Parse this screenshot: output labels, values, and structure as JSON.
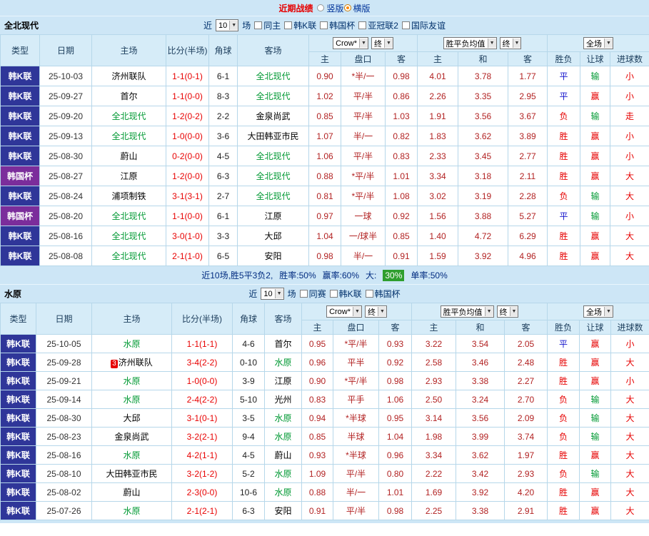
{
  "topbar": {
    "title": "近期战绩",
    "radios": [
      {
        "label": "竖版",
        "selected": false
      },
      {
        "label": "横版",
        "selected": true
      }
    ]
  },
  "colors": {
    "accent_red": "#e60000",
    "result_blue": "#1414cc",
    "result_green": "#009933",
    "focus_team_green": "#009933",
    "league_navy": "#2f3699",
    "cup_purple": "#7b2d9b",
    "panel_blue": "#cde6f6",
    "odds_maroon": "#b22222",
    "badge_green": "#2e9e2e"
  },
  "sections": [
    {
      "team": "全北现代",
      "filter": {
        "near": "近",
        "count": "10",
        "games": "场",
        "checkboxes": [
          {
            "label": "同主",
            "checked": false
          },
          {
            "label": "韩K联",
            "checked": false
          },
          {
            "label": "韩国杯",
            "checked": false
          },
          {
            "label": "亚冠联2",
            "checked": false
          },
          {
            "label": "国际友谊",
            "checked": false
          }
        ]
      },
      "columns": {
        "type": "类型",
        "date": "日期",
        "home": "主场",
        "score": "比分(半场)",
        "corner": "角球",
        "away": "客场",
        "odds_select": "Crow*",
        "odds_final": "终",
        "avg_select": "胜平负均值",
        "avg_final": "终",
        "scope_select": "全场",
        "sub": [
          "主",
          "盘口",
          "客",
          "主",
          "和",
          "客",
          "胜负",
          "让球",
          "进球数"
        ]
      },
      "rows": [
        {
          "lg": "韩K联",
          "cup": false,
          "d": "25-10-03",
          "h": "济州联队",
          "hf": false,
          "badge": "",
          "s": "1-1(0-1)",
          "c": "6-1",
          "a": "全北现代",
          "af": true,
          "o1": "0.90",
          "hcp": "*半/一",
          "o2": "0.98",
          "a1": "4.01",
          "a2": "3.78",
          "a3": "1.77",
          "res": [
            [
              "平",
              "b"
            ],
            [
              "输",
              "g"
            ],
            [
              "小",
              "r"
            ]
          ]
        },
        {
          "lg": "韩K联",
          "cup": false,
          "d": "25-09-27",
          "h": "首尔",
          "hf": false,
          "badge": "",
          "s": "1-1(0-0)",
          "c": "8-3",
          "a": "全北现代",
          "af": true,
          "o1": "1.02",
          "hcp": "平/半",
          "o2": "0.86",
          "a1": "2.26",
          "a2": "3.35",
          "a3": "2.95",
          "res": [
            [
              "平",
              "b"
            ],
            [
              "赢",
              "r"
            ],
            [
              "小",
              "r"
            ]
          ]
        },
        {
          "lg": "韩K联",
          "cup": false,
          "d": "25-09-20",
          "h": "全北现代",
          "hf": true,
          "badge": "",
          "s": "1-2(0-2)",
          "c": "2-2",
          "a": "金泉尚武",
          "af": false,
          "o1": "0.85",
          "hcp": "平/半",
          "o2": "1.03",
          "a1": "1.91",
          "a2": "3.56",
          "a3": "3.67",
          "res": [
            [
              "负",
              "r"
            ],
            [
              "输",
              "g"
            ],
            [
              "走",
              "r"
            ]
          ]
        },
        {
          "lg": "韩K联",
          "cup": false,
          "d": "25-09-13",
          "h": "全北现代",
          "hf": true,
          "badge": "",
          "s": "1-0(0-0)",
          "c": "3-6",
          "a": "大田韩亚市民",
          "af": false,
          "o1": "1.07",
          "hcp": "半/一",
          "o2": "0.82",
          "a1": "1.83",
          "a2": "3.62",
          "a3": "3.89",
          "res": [
            [
              "胜",
              "r"
            ],
            [
              "赢",
              "r"
            ],
            [
              "小",
              "r"
            ]
          ]
        },
        {
          "lg": "韩K联",
          "cup": false,
          "d": "25-08-30",
          "h": "蔚山",
          "hf": false,
          "badge": "",
          "s": "0-2(0-0)",
          "c": "4-5",
          "a": "全北现代",
          "af": true,
          "o1": "1.06",
          "hcp": "平/半",
          "o2": "0.83",
          "a1": "2.33",
          "a2": "3.45",
          "a3": "2.77",
          "res": [
            [
              "胜",
              "r"
            ],
            [
              "赢",
              "r"
            ],
            [
              "小",
              "r"
            ]
          ]
        },
        {
          "lg": "韩国杯",
          "cup": true,
          "d": "25-08-27",
          "h": "江原",
          "hf": false,
          "badge": "",
          "s": "1-2(0-0)",
          "c": "6-3",
          "a": "全北现代",
          "af": true,
          "o1": "0.88",
          "hcp": "*平/半",
          "o2": "1.01",
          "a1": "3.34",
          "a2": "3.18",
          "a3": "2.11",
          "res": [
            [
              "胜",
              "r"
            ],
            [
              "赢",
              "r"
            ],
            [
              "大",
              "r"
            ]
          ]
        },
        {
          "lg": "韩K联",
          "cup": false,
          "d": "25-08-24",
          "h": "浦项制铁",
          "hf": false,
          "badge": "",
          "s": "3-1(3-1)",
          "c": "2-7",
          "a": "全北现代",
          "af": true,
          "o1": "0.81",
          "hcp": "*平/半",
          "o2": "1.08",
          "a1": "3.02",
          "a2": "3.19",
          "a3": "2.28",
          "res": [
            [
              "负",
              "r"
            ],
            [
              "输",
              "g"
            ],
            [
              "大",
              "r"
            ]
          ]
        },
        {
          "lg": "韩国杯",
          "cup": true,
          "d": "25-08-20",
          "h": "全北现代",
          "hf": true,
          "badge": "",
          "s": "1-1(0-0)",
          "c": "6-1",
          "a": "江原",
          "af": false,
          "o1": "0.97",
          "hcp": "一球",
          "o2": "0.92",
          "a1": "1.56",
          "a2": "3.88",
          "a3": "5.27",
          "res": [
            [
              "平",
              "b"
            ],
            [
              "输",
              "g"
            ],
            [
              "小",
              "r"
            ]
          ]
        },
        {
          "lg": "韩K联",
          "cup": false,
          "d": "25-08-16",
          "h": "全北现代",
          "hf": true,
          "badge": "",
          "s": "3-0(1-0)",
          "c": "3-3",
          "a": "大邱",
          "af": false,
          "o1": "1.04",
          "hcp": "一/球半",
          "o2": "0.85",
          "a1": "1.40",
          "a2": "4.72",
          "a3": "6.29",
          "res": [
            [
              "胜",
              "r"
            ],
            [
              "赢",
              "r"
            ],
            [
              "大",
              "r"
            ]
          ]
        },
        {
          "lg": "韩K联",
          "cup": false,
          "d": "25-08-08",
          "h": "全北现代",
          "hf": true,
          "badge": "",
          "s": "2-1(1-0)",
          "c": "6-5",
          "a": "安阳",
          "af": false,
          "o1": "0.98",
          "hcp": "半/一",
          "o2": "0.91",
          "a1": "1.59",
          "a2": "3.92",
          "a3": "4.96",
          "res": [
            [
              "胜",
              "r"
            ],
            [
              "赢",
              "r"
            ],
            [
              "大",
              "r"
            ]
          ]
        }
      ],
      "summary": [
        {
          "t": "近10场,胜5平3负2,",
          "c": "navy"
        },
        {
          "t": "胜率:50%",
          "c": "navy"
        },
        {
          "t": "赢率:60%",
          "c": "navy"
        },
        {
          "t": "大:",
          "c": "navy"
        },
        {
          "t": "30%",
          "c": "badge"
        },
        {
          "t": "单率:50%",
          "c": "navy"
        }
      ]
    },
    {
      "team": "水原",
      "filter": {
        "near": "近",
        "count": "10",
        "games": "场",
        "checkboxes": [
          {
            "label": "同赛",
            "checked": false
          },
          {
            "label": "韩K联",
            "checked": false
          },
          {
            "label": "韩国杯",
            "checked": false
          }
        ]
      },
      "columns": {
        "type": "类型",
        "date": "日期",
        "home": "主场",
        "score": "比分(半场)",
        "corner": "角球",
        "away": "客场",
        "odds_select": "Crow*",
        "odds_final": "终",
        "avg_select": "胜平负均值",
        "avg_final": "终",
        "scope_select": "全场",
        "sub": [
          "主",
          "盘口",
          "客",
          "主",
          "和",
          "客",
          "胜负",
          "让球",
          "进球数"
        ]
      },
      "rows": [
        {
          "lg": "韩K联",
          "cup": false,
          "d": "25-10-05",
          "h": "水原",
          "hf": true,
          "badge": "",
          "s": "1-1(1-1)",
          "c": "4-6",
          "a": "首尔",
          "af": false,
          "o1": "0.95",
          "hcp": "*平/半",
          "o2": "0.93",
          "a1": "3.22",
          "a2": "3.54",
          "a3": "2.05",
          "res": [
            [
              "平",
              "b"
            ],
            [
              "赢",
              "r"
            ],
            [
              "小",
              "r"
            ]
          ]
        },
        {
          "lg": "韩K联",
          "cup": false,
          "d": "25-09-28",
          "h": "济州联队",
          "hf": false,
          "badge": "3",
          "s": "3-4(2-2)",
          "c": "0-10",
          "a": "水原",
          "af": true,
          "o1": "0.96",
          "hcp": "平半",
          "o2": "0.92",
          "a1": "2.58",
          "a2": "3.46",
          "a3": "2.48",
          "res": [
            [
              "胜",
              "r"
            ],
            [
              "赢",
              "r"
            ],
            [
              "大",
              "r"
            ]
          ]
        },
        {
          "lg": "韩K联",
          "cup": false,
          "d": "25-09-21",
          "h": "水原",
          "hf": true,
          "badge": "",
          "s": "1-0(0-0)",
          "c": "3-9",
          "a": "江原",
          "af": false,
          "o1": "0.90",
          "hcp": "*平/半",
          "o2": "0.98",
          "a1": "2.93",
          "a2": "3.38",
          "a3": "2.27",
          "res": [
            [
              "胜",
              "r"
            ],
            [
              "赢",
              "r"
            ],
            [
              "小",
              "r"
            ]
          ]
        },
        {
          "lg": "韩K联",
          "cup": false,
          "d": "25-09-14",
          "h": "水原",
          "hf": true,
          "badge": "",
          "s": "2-4(2-2)",
          "c": "5-10",
          "a": "光州",
          "af": false,
          "o1": "0.83",
          "hcp": "平手",
          "o2": "1.06",
          "a1": "2.50",
          "a2": "3.24",
          "a3": "2.70",
          "res": [
            [
              "负",
              "r"
            ],
            [
              "输",
              "g"
            ],
            [
              "大",
              "r"
            ]
          ]
        },
        {
          "lg": "韩K联",
          "cup": false,
          "d": "25-08-30",
          "h": "大邱",
          "hf": false,
          "badge": "",
          "s": "3-1(0-1)",
          "c": "3-5",
          "a": "水原",
          "af": true,
          "o1": "0.94",
          "hcp": "*半球",
          "o2": "0.95",
          "a1": "3.14",
          "a2": "3.56",
          "a3": "2.09",
          "res": [
            [
              "负",
              "r"
            ],
            [
              "输",
              "g"
            ],
            [
              "大",
              "r"
            ]
          ]
        },
        {
          "lg": "韩K联",
          "cup": false,
          "d": "25-08-23",
          "h": "金泉尚武",
          "hf": false,
          "badge": "",
          "s": "3-2(2-1)",
          "c": "9-4",
          "a": "水原",
          "af": true,
          "o1": "0.85",
          "hcp": "半球",
          "o2": "1.04",
          "a1": "1.98",
          "a2": "3.99",
          "a3": "3.74",
          "res": [
            [
              "负",
              "r"
            ],
            [
              "输",
              "g"
            ],
            [
              "大",
              "r"
            ]
          ]
        },
        {
          "lg": "韩K联",
          "cup": false,
          "d": "25-08-16",
          "h": "水原",
          "hf": true,
          "badge": "",
          "s": "4-2(1-1)",
          "c": "4-5",
          "a": "蔚山",
          "af": false,
          "o1": "0.93",
          "hcp": "*半球",
          "o2": "0.96",
          "a1": "3.34",
          "a2": "3.62",
          "a3": "1.97",
          "res": [
            [
              "胜",
              "r"
            ],
            [
              "赢",
              "r"
            ],
            [
              "大",
              "r"
            ]
          ]
        },
        {
          "lg": "韩K联",
          "cup": false,
          "d": "25-08-10",
          "h": "大田韩亚市民",
          "hf": false,
          "badge": "",
          "s": "3-2(1-2)",
          "c": "5-2",
          "a": "水原",
          "af": true,
          "o1": "1.09",
          "hcp": "平/半",
          "o2": "0.80",
          "a1": "2.22",
          "a2": "3.42",
          "a3": "2.93",
          "res": [
            [
              "负",
              "r"
            ],
            [
              "输",
              "g"
            ],
            [
              "大",
              "r"
            ]
          ]
        },
        {
          "lg": "韩K联",
          "cup": false,
          "d": "25-08-02",
          "h": "蔚山",
          "hf": false,
          "badge": "",
          "s": "2-3(0-0)",
          "c": "10-6",
          "a": "水原",
          "af": true,
          "o1": "0.88",
          "hcp": "半/一",
          "o2": "1.01",
          "a1": "1.69",
          "a2": "3.92",
          "a3": "4.20",
          "res": [
            [
              "胜",
              "r"
            ],
            [
              "赢",
              "r"
            ],
            [
              "大",
              "r"
            ]
          ]
        },
        {
          "lg": "韩K联",
          "cup": false,
          "d": "25-07-26",
          "h": "水原",
          "hf": true,
          "badge": "",
          "s": "2-1(2-1)",
          "c": "6-3",
          "a": "安阳",
          "af": false,
          "o1": "0.91",
          "hcp": "平/半",
          "o2": "0.98",
          "a1": "2.25",
          "a2": "3.38",
          "a3": "2.91",
          "res": [
            [
              "胜",
              "r"
            ],
            [
              "赢",
              "r"
            ],
            [
              "大",
              "r"
            ]
          ]
        }
      ],
      "summary": null
    }
  ]
}
